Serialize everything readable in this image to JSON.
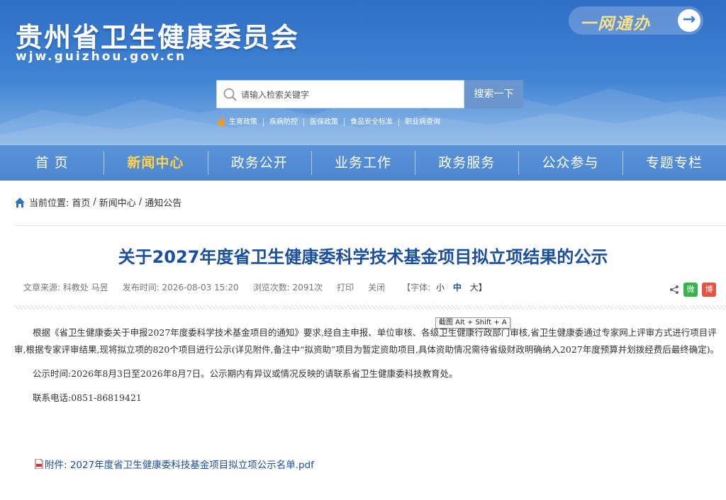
{
  "header": {
    "site_title": "贵州省卫生健康委员会",
    "site_url": "wjw.guizhou.gov.cn",
    "onenet_label": "一网通办",
    "search_placeholder": "请输入检索关键字",
    "search_button": "搜索一下",
    "hot_links": [
      "生育政策",
      "疾病防控",
      "医保政策",
      "食品安全标准",
      "职业病查询"
    ]
  },
  "nav": {
    "items": [
      "首 页",
      "新闻中心",
      "政务公开",
      "业务工作",
      "政务服务",
      "公众参与",
      "专题专栏"
    ],
    "active_index": 1
  },
  "breadcrumb": {
    "label": "当前位置:",
    "path": [
      "首页",
      "/",
      "新闻中心",
      "/",
      "通知公告"
    ]
  },
  "article": {
    "title": "关于2027年度省卫生健康委科学技术基金项目拟立项结果的公示",
    "meta": {
      "source": "文章来源: 科教处 马昱",
      "time": "发布时间: 2026-08-03 15:20",
      "views": "浏览次数: 2091次",
      "print": "打印",
      "close": "关闭",
      "font_label": "【字体:",
      "font_small": "小",
      "font_mid": "中",
      "font_big": "大】"
    },
    "paragraphs": [
      "根据《省卫生健康委关于申报2027年度委科学技术基金项目的通知》要求,经自主申报、单位审核、各级卫生健康行政部门审核,省卫生健康委通过专家网上评审方式进行项目评审,根据专家评审结果,现将拟立项的820个项目进行公示(详见附件,备注中“拟资助”项目为暂定资助项目,具体资助情况需待省级财政明确纳入2027年度预算并划拨经费后最终确定)。",
      "公示时间:2026年8月3日至2026年8月7日。公示期内有异议或情况反映的请联系省卫生健康委科技教育处。",
      "联系电话:0851-86819421"
    ],
    "attachment": "附件: 2027年度省卫生健康委科技基金项目拟立项公示名单.pdf"
  },
  "tooltip": "截图 Alt + Shift + A",
  "share": {
    "wechat_glyph": "微",
    "weibo_glyph": "博"
  },
  "colors": {
    "banner": "#3d80d2",
    "nav": "#5b93d8",
    "nav_active": "#ffd24a",
    "title": "#1a4fa0"
  }
}
